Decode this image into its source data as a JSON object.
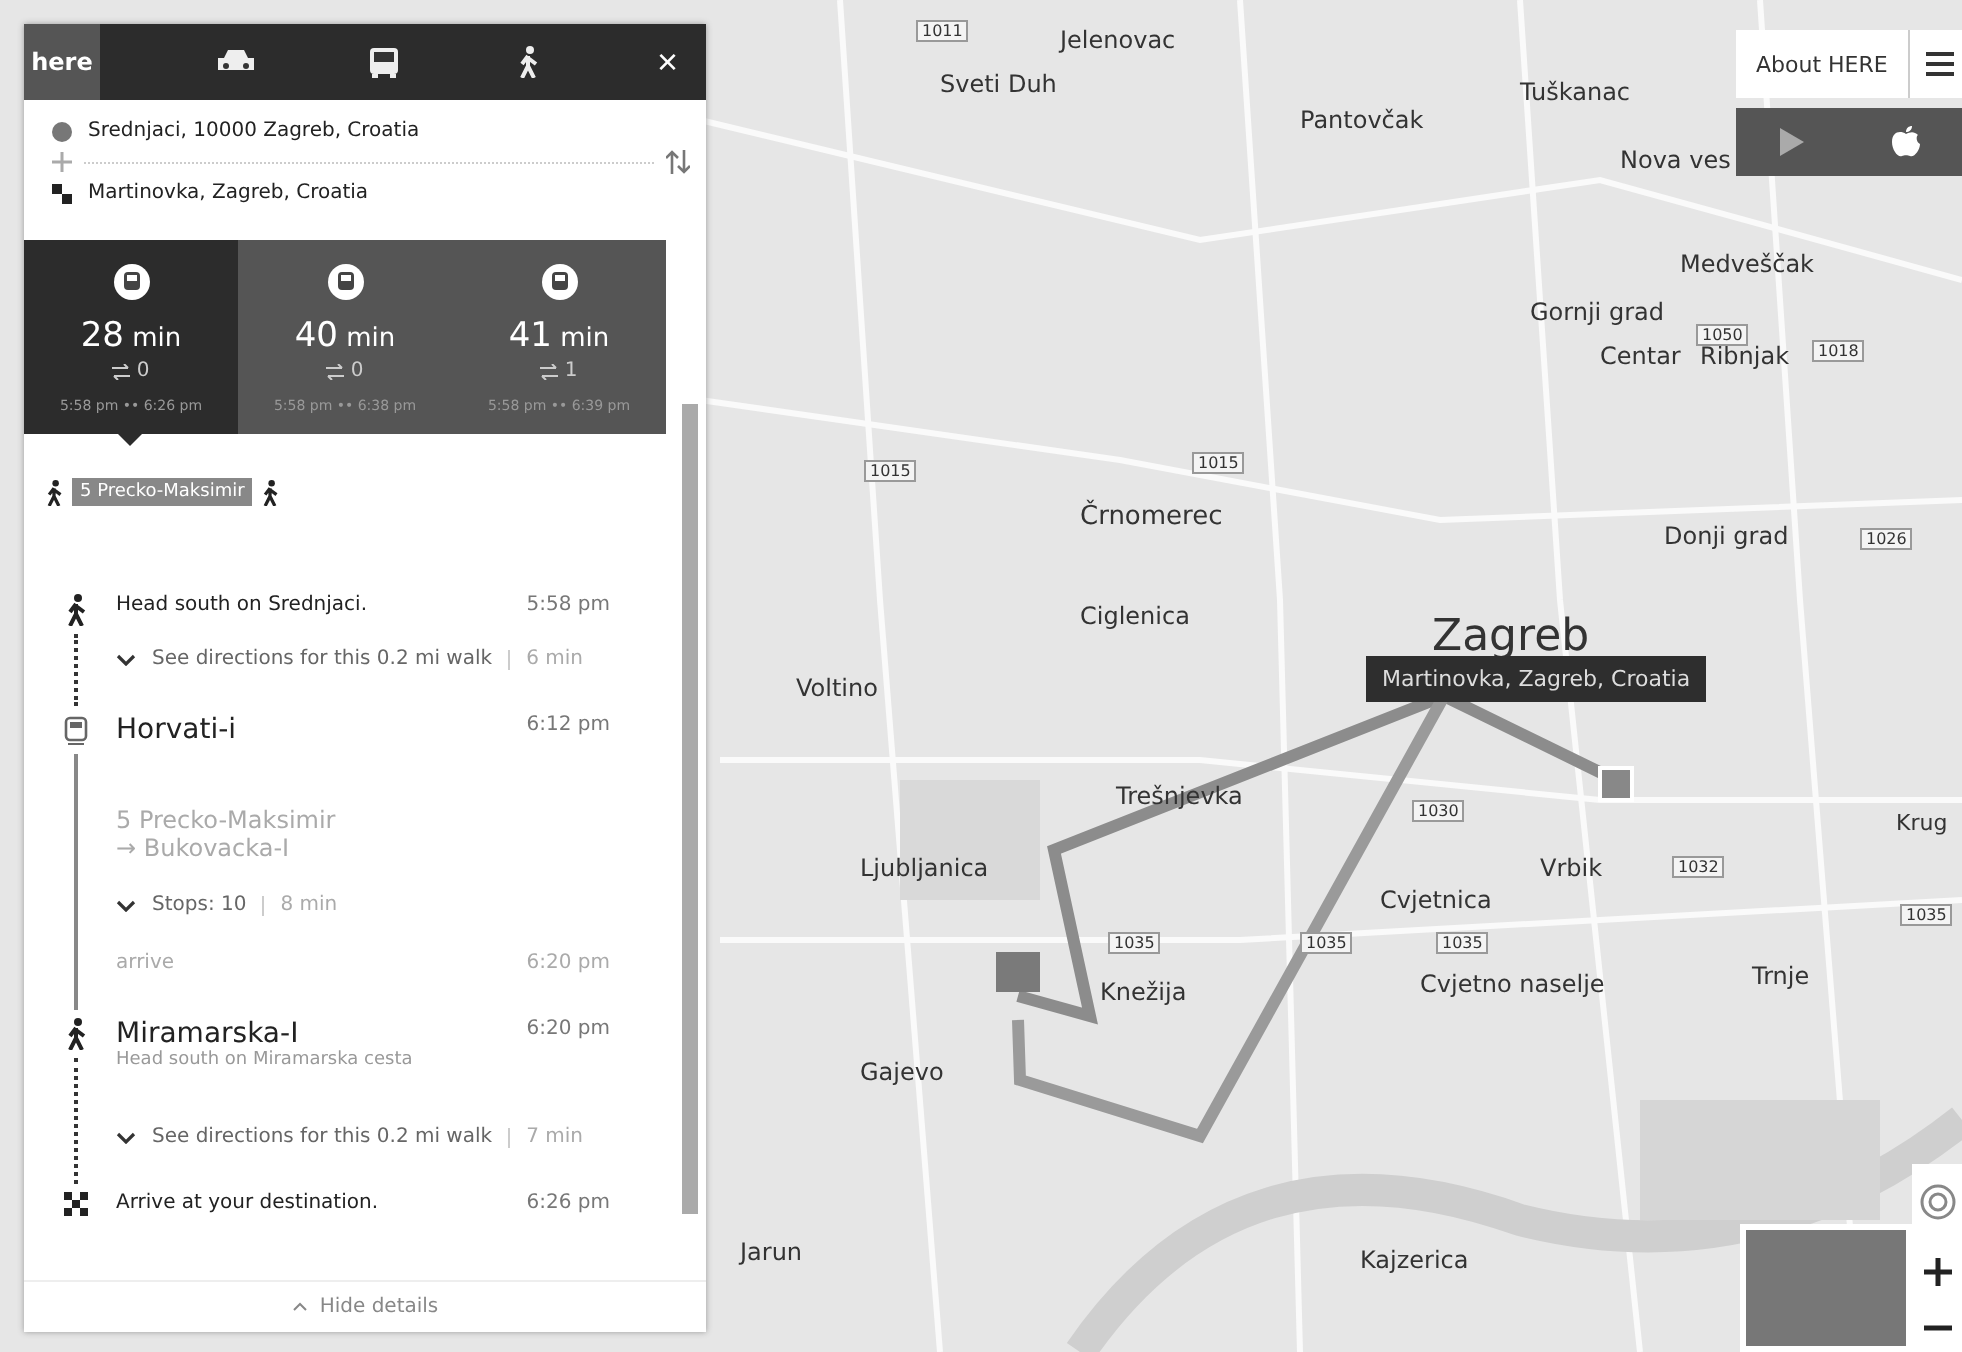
{
  "header": {
    "logo": "here",
    "close": "×"
  },
  "route": {
    "from": "Srednjaci, 10000 Zagreb, Croatia",
    "to": "Martinovka, Zagreb, Croatia"
  },
  "options": [
    {
      "duration": "28",
      "unit": "min",
      "transfers": "0",
      "times": "5:58 pm •• 6:26 pm",
      "selected": true
    },
    {
      "duration": "40",
      "unit": "min",
      "transfers": "0",
      "times": "5:58 pm •• 6:38 pm",
      "selected": false
    },
    {
      "duration": "41",
      "unit": "min",
      "transfers": "1",
      "times": "5:58 pm •• 6:39 pm",
      "selected": false
    }
  ],
  "summary": {
    "line": "5 Precko-Maksimir"
  },
  "steps": [
    {
      "kind": "walk_start",
      "title": "Head south on Srednjaci.",
      "time": "5:58 pm",
      "expand": "See directions for this 0.2 mi walk",
      "duration": "6 min"
    },
    {
      "kind": "transit",
      "title": "Horvati-i",
      "time": "6:12 pm",
      "line": "5 Precko-Maksimir",
      "direction": "→ Bukovacka-I",
      "expand": "Stops: 10",
      "duration": "8 min",
      "arrive": "arrive",
      "arrive_time": "6:20 pm"
    },
    {
      "kind": "walk",
      "title": "Miramarska-I",
      "subtitle": "Head south on Miramarska cesta",
      "time": "6:20 pm",
      "expand": "See directions for this 0.2 mi walk",
      "duration": "7 min"
    },
    {
      "kind": "arrive",
      "title": "Arrive at your destination.",
      "time": "6:26 pm"
    }
  ],
  "hide_details": "Hide details",
  "about": "About HERE",
  "map": {
    "tooltip": "Martinovka, Zagreb, Croatia",
    "labels": [
      "Jelenovac",
      "Sveti Duh",
      "Tuškanac",
      "Pantovčak",
      "Nova ves",
      "Medveščak",
      "Gornji grad",
      "Centar",
      "Ribnjak",
      "Črnomerec",
      "Zagreb",
      "Ciglenica",
      "Voltino",
      "Trešnjevka",
      "Ljubljanica",
      "Vrbik",
      "Cvjetnica",
      "Knežija",
      "Cvjetno naselje",
      "Trnje",
      "Gajevo",
      "Jarun",
      "Kajzerica",
      "Donji grad",
      "Krug"
    ],
    "roads": [
      "1011",
      "1015",
      "1015",
      "1050",
      "1018",
      "1026",
      "1035",
      "1035",
      "1030",
      "1035",
      "1032",
      "1035"
    ]
  }
}
